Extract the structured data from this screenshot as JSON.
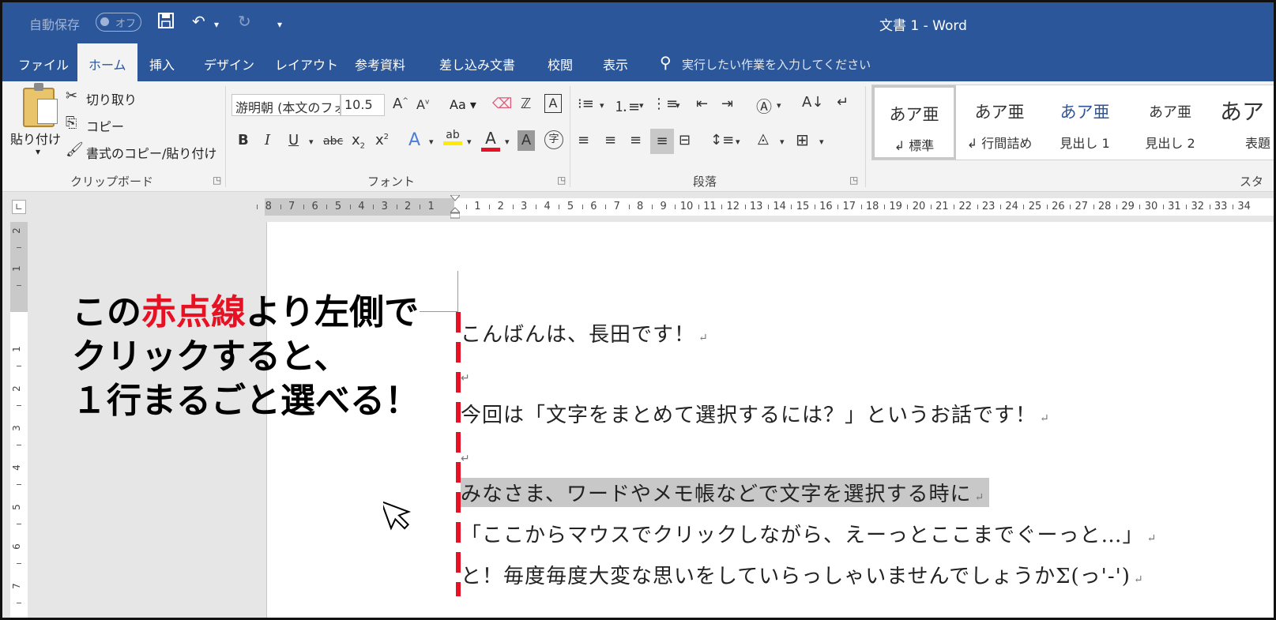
{
  "titlebar": {
    "autosave_label": "自動保存",
    "autosave_state": "オフ",
    "title": "文書 1  -  Word"
  },
  "tabs": [
    {
      "label": "ファイル",
      "active": false
    },
    {
      "label": "ホーム",
      "active": true
    },
    {
      "label": "挿入",
      "active": false
    },
    {
      "label": "デザイン",
      "active": false
    },
    {
      "label": "レイアウト",
      "active": false
    },
    {
      "label": "参考資料",
      "active": false
    },
    {
      "label": "差し込み文書",
      "active": false
    },
    {
      "label": "校閲",
      "active": false
    },
    {
      "label": "表示",
      "active": false
    }
  ],
  "tell_me": "実行したい作業を入力してください",
  "clipboard": {
    "paste": "貼り付け",
    "cut": "切り取り",
    "copy": "コピー",
    "format_painter": "書式のコピー/貼り付け",
    "group_label": "クリップボード"
  },
  "font": {
    "font_name": "游明朝 (本文のフォント)",
    "font_size": "10.5",
    "change_case": "Aa",
    "group_label": "フォント"
  },
  "paragraph": {
    "group_label": "段落"
  },
  "styles": {
    "group_label": "スタイル",
    "items": [
      {
        "sample": "あア亜",
        "name": "↲ 標準"
      },
      {
        "sample": "あア亜",
        "name": "↲ 行間詰め"
      },
      {
        "sample": "あア亜",
        "name": "見出し 1"
      },
      {
        "sample": "あア亜",
        "name": "見出し 2"
      },
      {
        "sample": "あア",
        "name": "表題"
      }
    ]
  },
  "ruler": {
    "left_numbers": [
      "8",
      "7",
      "6",
      "5",
      "4",
      "3",
      "2",
      "1"
    ],
    "right_numbers": [
      "1",
      "2",
      "3",
      "4",
      "5",
      "6",
      "7",
      "8",
      "9",
      "10",
      "11",
      "12",
      "13",
      "14",
      "15",
      "16",
      "17",
      "18",
      "19",
      "20",
      "21",
      "22",
      "23",
      "24",
      "25",
      "26",
      "27",
      "28",
      "29",
      "30",
      "31",
      "32",
      "33",
      "34"
    ],
    "vertical_numbers": [
      "2",
      "1",
      "1",
      "2",
      "3",
      "4",
      "5",
      "6",
      "7"
    ]
  },
  "document": {
    "lines": [
      {
        "text": "こんばんは、長田です！",
        "highlight": false
      },
      {
        "text": "",
        "highlight": false
      },
      {
        "text": "今回は「文字をまとめて選択するには？」というお話です！",
        "highlight": false
      },
      {
        "text": "",
        "highlight": false
      },
      {
        "text": "みなさま、ワードやメモ帳などで文字を選択する時に",
        "highlight": true
      },
      {
        "text": "「ここからマウスでクリックしながら、えーっとここまでぐーっと…」",
        "highlight": false
      },
      {
        "text": "と！毎度毎度大変な思いをしていらっしゃいませんでしょうかΣ(っ'-')",
        "highlight": false
      }
    ],
    "paragraph_mark": "↵"
  },
  "annotation": {
    "line1_a": "この",
    "line1_red": "赤点線",
    "line1_b": "より左側で",
    "line2": "クリックすると、",
    "line3": "１行まるごと選べる！"
  },
  "colors": {
    "word_blue": "#2b579a",
    "annotation_red": "#e81123",
    "selection_gray": "#c8c8c8"
  }
}
